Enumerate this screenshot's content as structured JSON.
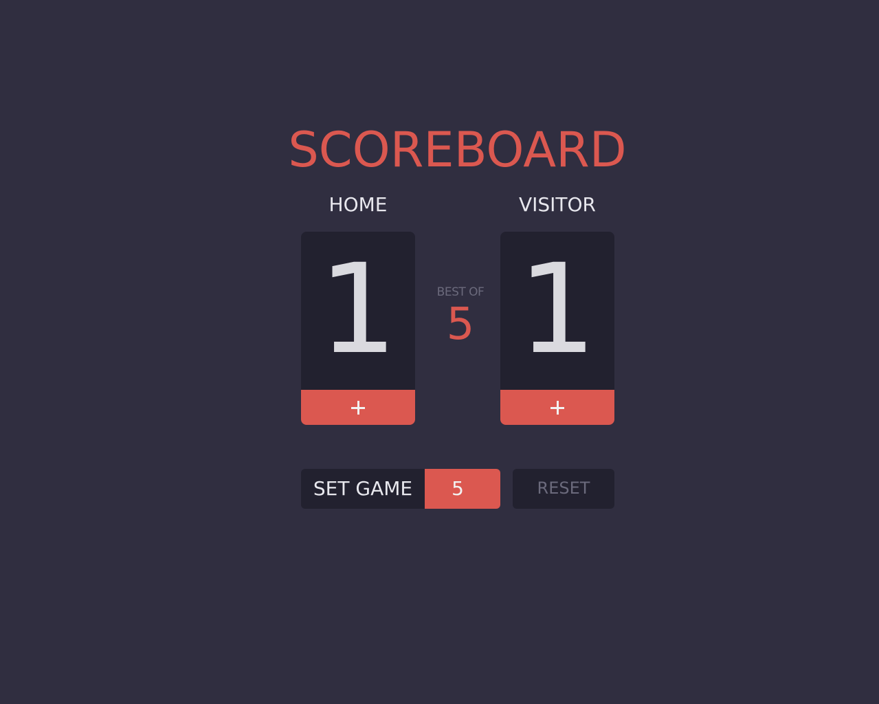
{
  "app": {
    "title": "SCOREBOARD"
  },
  "home": {
    "label": "HOME",
    "score": "1",
    "add_label": "+"
  },
  "visitor": {
    "label": "VISITOR",
    "score": "1",
    "add_label": "+"
  },
  "best_of": {
    "label": "BEST OF",
    "value": "5"
  },
  "controls": {
    "set_game_label": "SET GAME",
    "set_game_value": "5",
    "reset_label": "RESET"
  },
  "colors": {
    "background": "#302e40",
    "card": "#22212f",
    "accent": "#db5850",
    "text": "#e8e8ee",
    "muted": "#6b6a7c"
  },
  "icons": {
    "add_home": "plus-icon",
    "add_visitor": "plus-icon"
  }
}
